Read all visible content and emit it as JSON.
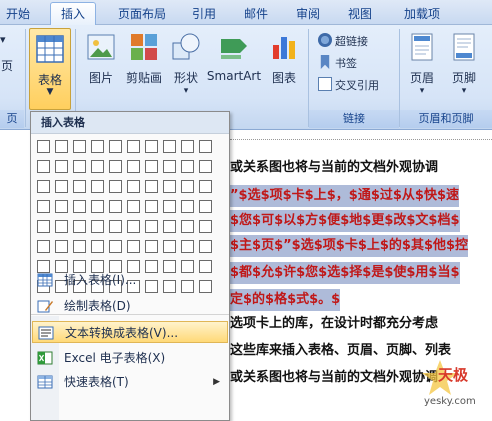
{
  "tabs": [
    "开始",
    "插入",
    "页面布局",
    "引用",
    "邮件",
    "审阅",
    "视图",
    "加载项"
  ],
  "ribbon": {
    "left_partial": {
      "top": "",
      "bottom": "页",
      "caption": "页"
    },
    "table_button": "表格",
    "illustrations": [
      "图片",
      "剪贴画",
      "形状",
      "SmartArt",
      "图表"
    ],
    "links": [
      "超链接",
      "书签",
      "交叉引用"
    ],
    "links_caption": "链接",
    "header_footer": [
      "页眉",
      "页脚"
    ],
    "header_footer_caption": "页眉和页脚"
  },
  "dropdown": {
    "title": "插入表格",
    "grid": {
      "cols": 10,
      "rows": 8
    },
    "items": [
      {
        "label": "插入表格(I)...",
        "icon": "insert-table-icon"
      },
      {
        "label": "绘制表格(D)",
        "icon": "draw-table-icon"
      },
      {
        "label": "文本转换成表格(V)...",
        "icon": "text-to-table-icon",
        "highlighted": true
      },
      {
        "label": "Excel 电子表格(X)",
        "icon": "excel-icon"
      },
      {
        "label": "快速表格(T)",
        "icon": "quick-table-icon",
        "submenu": true
      }
    ]
  },
  "document": {
    "lines": [
      {
        "text": "或关系图也将与当前的文档外观协调",
        "selected": false
      },
      {
        "text": "”$选$项$卡$上$，$通$过$从$快$速",
        "selected": true
      },
      {
        "text": "$您$可$以$方$便$地$更$改$文$档$",
        "selected": true
      },
      {
        "text": "$主$页$”$选$项$卡$上$的$其$他$控",
        "selected": true
      },
      {
        "text": "$都$允$许$您$选$择$是$使$用$当$",
        "selected": true
      },
      {
        "text": "定$的$格$式$。$",
        "selected": true
      },
      {
        "text": "选项卡上的库，在设计时都充分考虑",
        "selected": false
      },
      {
        "text": "这些库来插入表格、页眉、页脚、列表",
        "selected": false
      },
      {
        "text": "或关系图也将与当前的文档外观协调",
        "selected": false
      }
    ]
  },
  "watermark": {
    "brand": "天极",
    "site": "yesky.com"
  }
}
